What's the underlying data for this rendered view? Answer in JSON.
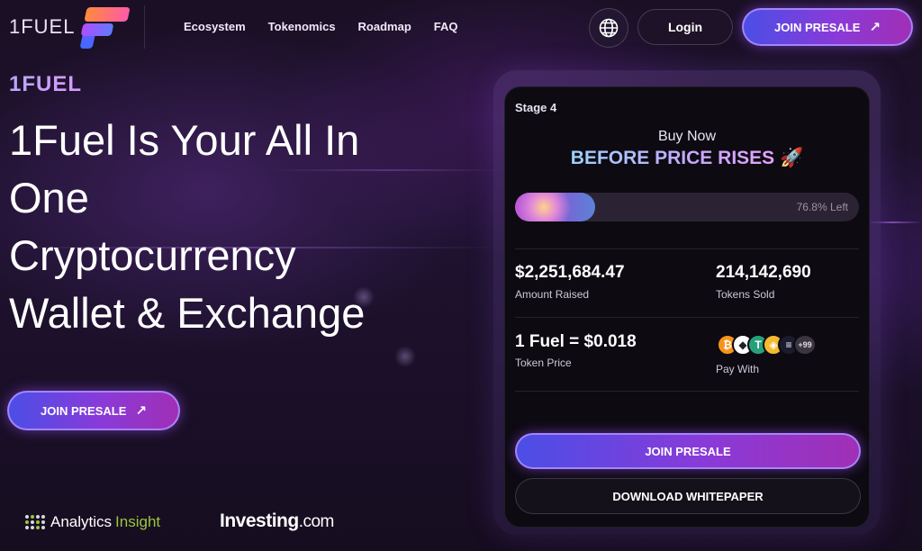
{
  "header": {
    "logo_text": "1FUEL",
    "nav": [
      "Ecosystem",
      "Tokenomics",
      "Roadmap",
      "FAQ"
    ],
    "login_label": "Login",
    "presale_label": "JOIN PRESALE",
    "globe_icon": "globe-icon",
    "arrow_icon": "arrow-up-right-icon"
  },
  "hero": {
    "brand_tag": "1FUEL",
    "title_lines": [
      "1Fuel Is Your All In",
      "One",
      "Cryptocurrency",
      "Wallet & Exchange"
    ],
    "presale_label": "JOIN PRESALE"
  },
  "partners": {
    "analytics": "Analytics",
    "insight": "Insight",
    "investing": "Investing",
    "investing_suffix": ".com"
  },
  "presale_card": {
    "stage": "Stage 4",
    "buy_now": "Buy Now",
    "headline": "BEFORE PRICE RISES",
    "rocket_icon": "🚀",
    "progress_fraction_filled": 0.232,
    "progress_label": "76.8% Left",
    "amount_raised_value": "$2,251,684.47",
    "amount_raised_label": "Amount Raised",
    "tokens_sold_value": "214,142,690",
    "tokens_sold_label": "Tokens Sold",
    "token_price_value": "1 Fuel = $0.018",
    "token_price_label": "Token Price",
    "pay_with_label": "Pay With",
    "coins": [
      {
        "name": "bitcoin-icon",
        "glyph": "₿",
        "color": "#f7931a"
      },
      {
        "name": "ethereum-icon",
        "glyph": "◆",
        "color": "#ffffff"
      },
      {
        "name": "tether-icon",
        "glyph": "T",
        "color": "#26a17b"
      },
      {
        "name": "bnb-icon",
        "glyph": "◈",
        "color": "#f3ba2f"
      },
      {
        "name": "solana-icon",
        "glyph": "≡",
        "color": "#1b1b2e"
      }
    ],
    "coins_more": "+99",
    "presale_label": "JOIN PRESALE",
    "whitepaper_label": "DOWNLOAD WHITEPAPER"
  },
  "colors": {
    "accent_purple": "#8a3ad8",
    "accent_blue": "#4b4ee6",
    "analytics_green": "#9ac63b"
  }
}
